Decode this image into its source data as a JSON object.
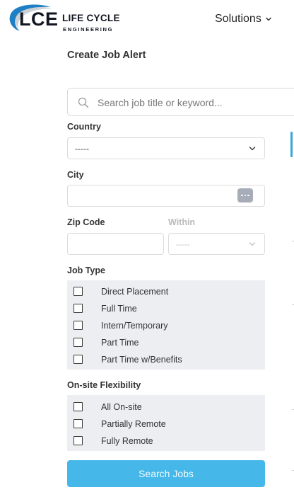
{
  "header": {
    "logo": {
      "letters": "LCE",
      "line1": "LIFE CYCLE",
      "line2": "ENGINEERING"
    },
    "nav": {
      "solutions_label": "Solutions"
    }
  },
  "form": {
    "title": "Create Job Alert",
    "search": {
      "placeholder": "Search job title or keyword..."
    },
    "country": {
      "label": "Country",
      "value": "-----"
    },
    "city": {
      "label": "City",
      "value": ""
    },
    "zip": {
      "label": "Zip Code",
      "value": ""
    },
    "within": {
      "label": "Within",
      "value": "-----"
    },
    "job_type": {
      "label": "Job Type",
      "options": [
        "Direct Placement",
        "Full Time",
        "Intern/Temporary",
        "Part Time",
        "Part Time w/Benefits"
      ]
    },
    "flexibility": {
      "label": "On-site Flexibility",
      "options": [
        "All On-site",
        "Partially Remote",
        "Fully Remote"
      ]
    },
    "submit_label": "Search Jobs"
  },
  "colors": {
    "accent": "#45b8e9",
    "panel": "#eceef1",
    "logo_arc": "#1f7fc4"
  },
  "icons": {
    "search": "search-icon",
    "dropdown": "chevron-down-icon",
    "password_manager": "more-dots-icon"
  }
}
